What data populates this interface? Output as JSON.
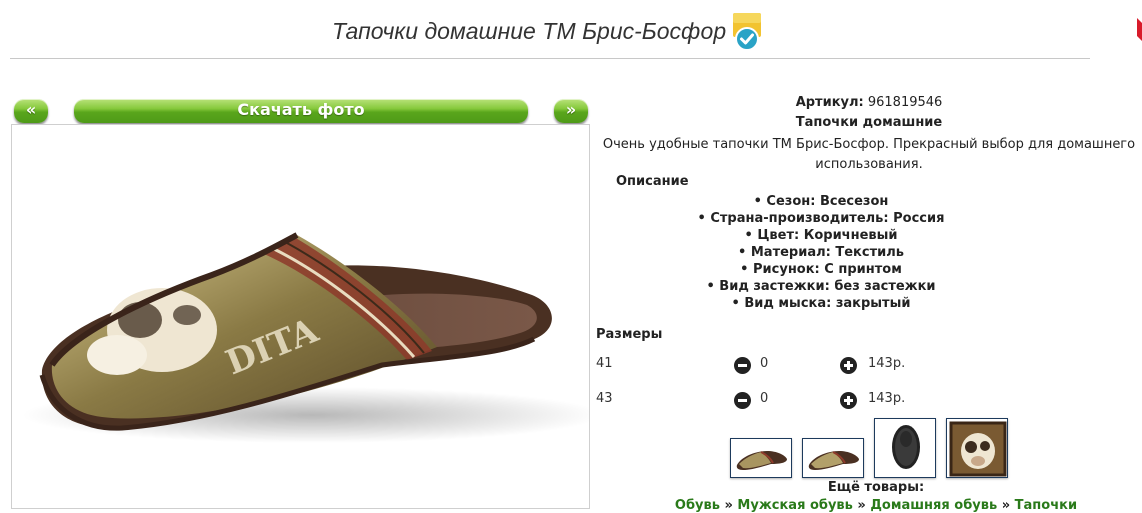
{
  "header": {
    "title": "Тапочки домашние ТМ Брис-Босфор",
    "badge_icon": "verified-check-icon"
  },
  "gallery": {
    "prev_label": "«",
    "next_label": "»",
    "download_label": "Скачать фото"
  },
  "product": {
    "article_label": "Артикул:",
    "article_value": "961819546",
    "name": "Тапочки домашние",
    "description": "Очень удобные тапочки ТМ Брис-Босфор. Прекрасный выбор для домашнего использования.",
    "description_title": "Описание",
    "specs": [
      "Сезон: Всесезон",
      "Страна-производитель: Россия",
      "Цвет: Коричневый",
      "Материал: Текстиль",
      "Рисунок: С принтом",
      "Вид застежки: без застежки",
      "Вид мыска: закрытый"
    ]
  },
  "sizes": {
    "title": "Размеры",
    "rows": [
      {
        "size": "41",
        "qty": "0",
        "price": "143р."
      },
      {
        "size": "43",
        "qty": "0",
        "price": "143р."
      }
    ]
  },
  "thumbnails": [
    {
      "icon": "slipper-side-thumb"
    },
    {
      "icon": "slipper-side-thumb"
    },
    {
      "icon": "slipper-sole-thumb"
    },
    {
      "icon": "dog-print-thumb"
    }
  ],
  "more": {
    "title": "Ещё товары:",
    "separator": "»",
    "crumbs": [
      "Обувь",
      "Мужская обувь",
      "Домашняя обувь",
      "Тапочки"
    ]
  },
  "colors": {
    "accent_green": "#5aa61c",
    "link_green": "#2a7a1a",
    "slipper_brown": "#4a3022"
  }
}
